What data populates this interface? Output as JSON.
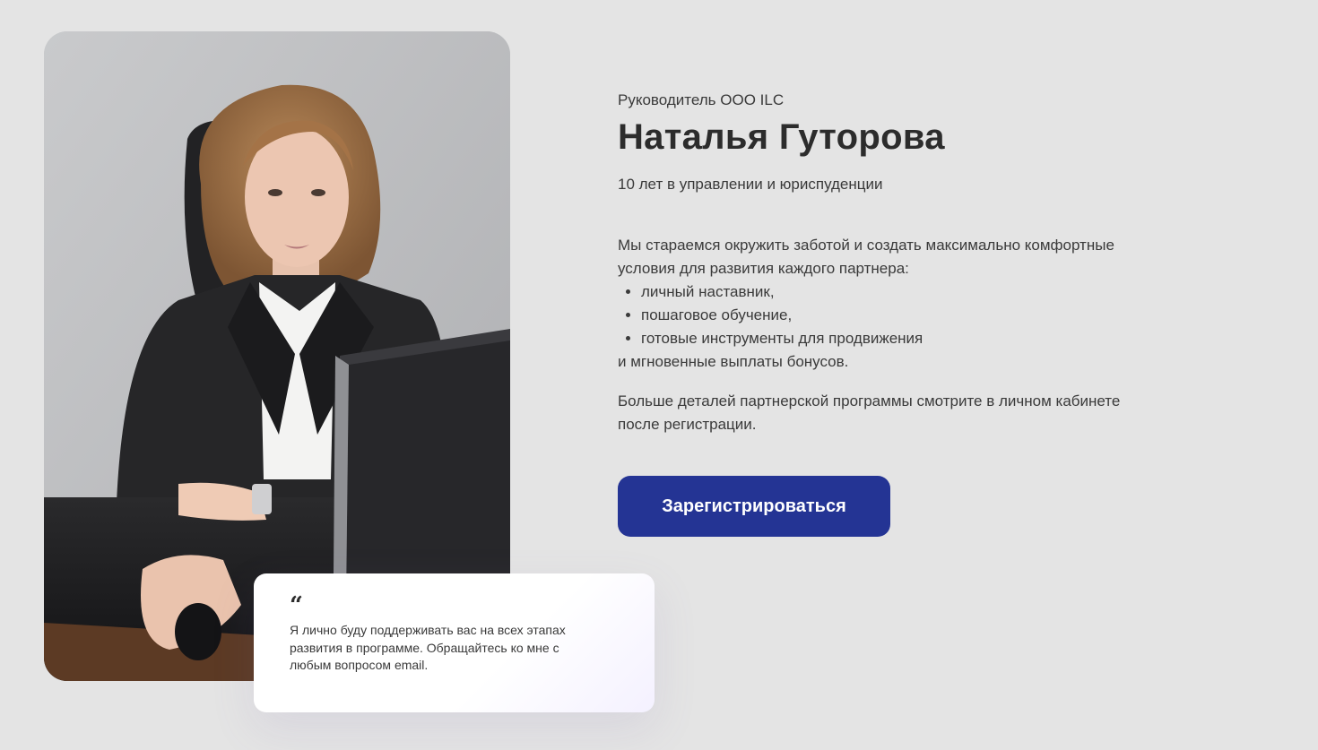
{
  "profile": {
    "role": "Руководитель ООО ILC",
    "name": "Наталья Гуторова",
    "experience": "10 лет в управлении и юриспуденции"
  },
  "description": {
    "intro": "Мы стараемся окружить заботой и создать максимально комфортные условия для развития каждого партнера:",
    "items": [
      "личный наставник,",
      "пошаговое обучение,",
      "готовые инструменты для продвижения"
    ],
    "outro": "и мгновенные выплаты бонусов."
  },
  "details": "Больше деталей партнерской программы смотрите в личном кабинете после регистрации.",
  "cta": {
    "label": "Зарегистрироваться",
    "color": "#243494"
  },
  "quote": {
    "mark": "“",
    "text": "Я лично буду поддерживать вас на всех этапах развития в программе. Обращайтесь ко мне с любым вопросом email."
  },
  "colors": {
    "background": "#e4e4e4",
    "text": "#2d2d2d",
    "accent": "#243494"
  }
}
